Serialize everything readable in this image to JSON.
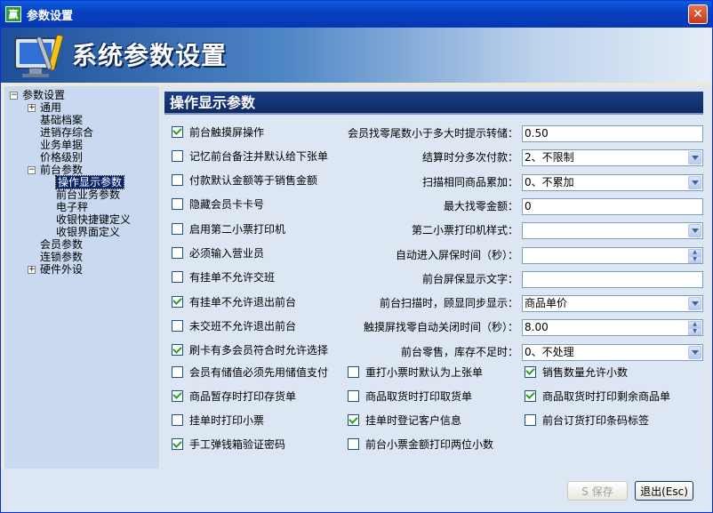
{
  "window": {
    "title": "参数设置",
    "app_icon_text": "赢"
  },
  "banner": {
    "title": "系统参数设置"
  },
  "tree": [
    {
      "label": "参数设置",
      "expander": "−"
    },
    {
      "label": "通用",
      "expander": "+"
    },
    {
      "label": "基础档案"
    },
    {
      "label": "进销存综合"
    },
    {
      "label": "业务单据"
    },
    {
      "label": "价格级别"
    },
    {
      "label": "前台参数",
      "expander": "−"
    },
    {
      "label": "操作显示参数",
      "selected": true
    },
    {
      "label": "前台业务参数"
    },
    {
      "label": "电子秤"
    },
    {
      "label": "收银快捷键定义"
    },
    {
      "label": "收银界面定义"
    },
    {
      "label": "会员参数"
    },
    {
      "label": "连锁参数"
    },
    {
      "label": "硬件外设",
      "expander": "+"
    }
  ],
  "panel": {
    "title": "操作显示参数"
  },
  "left_checks": [
    {
      "label": "前台触摸屏操作",
      "checked": true
    },
    {
      "label": "记忆前台备注并默认给下张单",
      "checked": false
    },
    {
      "label": "付款默认金额等于销售金额",
      "checked": false
    },
    {
      "label": "隐藏会员卡卡号",
      "checked": false
    },
    {
      "label": "启用第二小票打印机",
      "checked": false
    },
    {
      "label": "必须输入营业员",
      "checked": false
    },
    {
      "label": "有挂单不允许交班",
      "checked": false
    },
    {
      "label": "有挂单不允许退出前台",
      "checked": true
    },
    {
      "label": "未交班不允许退出前台",
      "checked": false
    },
    {
      "label": "刷卡有多会员符合时允许选择",
      "checked": true
    }
  ],
  "fields": [
    {
      "label": "会员找零尾数小于多大时提示转储：",
      "value": "0.50",
      "kind": "text"
    },
    {
      "label": "结算时分多次付款：",
      "value": "2、不限制",
      "kind": "dropdown"
    },
    {
      "label": "扫描相同商品累加：",
      "value": "0、不累加",
      "kind": "dropdown"
    },
    {
      "label": "最大找零金额：",
      "value": "0",
      "kind": "text"
    },
    {
      "label": "第二小票打印机样式：",
      "value": "",
      "kind": "dropdown"
    },
    {
      "label": "自动进入屏保时间（秒）：",
      "value": "",
      "kind": "spin"
    },
    {
      "label": "前台屏保显示文字：",
      "value": "",
      "kind": "text"
    },
    {
      "label": "前台扫描时，顾显同步显示：",
      "value": "商品单价",
      "kind": "dropdown"
    },
    {
      "label": "触摸屏找零自动关闭时间（秒）：",
      "value": "8.00",
      "kind": "spin"
    },
    {
      "label": "前台零售，库存不足时：",
      "value": "0、不处理",
      "kind": "dropdown"
    }
  ],
  "grid_checks": [
    [
      {
        "label": "会员有储值必须先用储值支付",
        "checked": false
      },
      {
        "label": "重打小票时默认为上张单",
        "checked": false
      },
      {
        "label": "销售数量允许小数",
        "checked": true
      }
    ],
    [
      {
        "label": "商品暂存时打印存货单",
        "checked": true
      },
      {
        "label": "商品取货时打印取货单",
        "checked": false
      },
      {
        "label": "商品取货时打印剩余商品单",
        "checked": true
      }
    ],
    [
      {
        "label": "挂单时打印小票",
        "checked": false
      },
      {
        "label": "挂单时登记客户信息",
        "checked": true
      },
      {
        "label": "前台订货打印条码标签",
        "checked": false
      }
    ],
    [
      {
        "label": "手工弹钱箱验证密码",
        "checked": true
      },
      {
        "label": "前台小票金额打印两位小数",
        "checked": false
      }
    ]
  ],
  "buttons": {
    "save": "S 保存",
    "exit": "退出(Esc)"
  }
}
